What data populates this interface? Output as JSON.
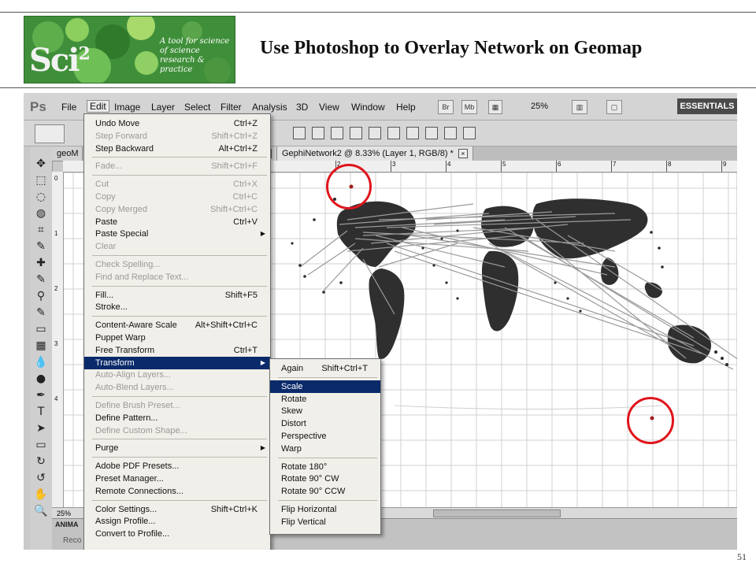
{
  "slide": {
    "title": "Use Photoshop to Overlay Network on Geomap",
    "page_number": "51",
    "logo": {
      "brand": "Sci",
      "sup": "2",
      "tagline": "A tool for science of science research & practice"
    }
  },
  "app": {
    "logo": "Ps",
    "menubar": [
      "File",
      "Edit",
      "Image",
      "Layer",
      "Select",
      "Filter",
      "Analysis",
      "3D",
      "View",
      "Window",
      "Help"
    ],
    "active_menu": "Edit",
    "bridge_btn": "Br",
    "minibridge_btn": "Mb",
    "zoom": "25%",
    "workspace": "ESSENTIALS"
  },
  "document_tabs": [
    {
      "label": "geoM",
      "close": "×"
    },
    {
      "label": ") *",
      "close": "×"
    },
    {
      "label": "GephiNetwork2 @ 8.33% (Layer 1, RGB/8) *",
      "close": "×"
    }
  ],
  "ruler_top": [
    "2",
    "3",
    "4",
    "5",
    "6",
    "7",
    "8",
    "9"
  ],
  "ruler_left": [
    "0",
    "1",
    "2",
    "3",
    "4"
  ],
  "status_zoom": "25%",
  "animation_panel": {
    "tab": "ANIMA",
    "record": "Reco"
  },
  "edit_menu": [
    {
      "label": "Undo Move",
      "shortcut": "Ctrl+Z",
      "disabled": false
    },
    {
      "label": "Step Forward",
      "shortcut": "Shift+Ctrl+Z",
      "disabled": true
    },
    {
      "label": "Step Backward",
      "shortcut": "Alt+Ctrl+Z",
      "disabled": false
    },
    {
      "sep": true
    },
    {
      "label": "Fade...",
      "shortcut": "Shift+Ctrl+F",
      "disabled": true
    },
    {
      "sep": true
    },
    {
      "label": "Cut",
      "shortcut": "Ctrl+X",
      "disabled": true
    },
    {
      "label": "Copy",
      "shortcut": "Ctrl+C",
      "disabled": true
    },
    {
      "label": "Copy Merged",
      "shortcut": "Shift+Ctrl+C",
      "disabled": true
    },
    {
      "label": "Paste",
      "shortcut": "Ctrl+V",
      "disabled": false
    },
    {
      "label": "Paste Special",
      "shortcut": "",
      "disabled": false,
      "submenu": true
    },
    {
      "label": "Clear",
      "shortcut": "",
      "disabled": true
    },
    {
      "sep": true
    },
    {
      "label": "Check Spelling...",
      "shortcut": "",
      "disabled": true
    },
    {
      "label": "Find and Replace Text...",
      "shortcut": "",
      "disabled": true
    },
    {
      "sep": true
    },
    {
      "label": "Fill...",
      "shortcut": "Shift+F5",
      "disabled": false
    },
    {
      "label": "Stroke...",
      "shortcut": "",
      "disabled": false
    },
    {
      "sep": true
    },
    {
      "label": "Content-Aware Scale",
      "shortcut": "Alt+Shift+Ctrl+C",
      "disabled": false
    },
    {
      "label": "Puppet Warp",
      "shortcut": "",
      "disabled": false
    },
    {
      "label": "Free Transform",
      "shortcut": "Ctrl+T",
      "disabled": false
    },
    {
      "label": "Transform",
      "shortcut": "",
      "disabled": false,
      "submenu": true,
      "highlighted": true
    },
    {
      "label": "Auto-Align Layers...",
      "shortcut": "",
      "disabled": true
    },
    {
      "label": "Auto-Blend Layers...",
      "shortcut": "",
      "disabled": true
    },
    {
      "sep": true
    },
    {
      "label": "Define Brush Preset...",
      "shortcut": "",
      "disabled": true
    },
    {
      "label": "Define Pattern...",
      "shortcut": "",
      "disabled": false
    },
    {
      "label": "Define Custom Shape...",
      "shortcut": "",
      "disabled": true
    },
    {
      "sep": true
    },
    {
      "label": "Purge",
      "shortcut": "",
      "disabled": false,
      "submenu": true
    },
    {
      "sep": true
    },
    {
      "label": "Adobe PDF Presets...",
      "shortcut": "",
      "disabled": false
    },
    {
      "label": "Preset Manager...",
      "shortcut": "",
      "disabled": false
    },
    {
      "label": "Remote Connections...",
      "shortcut": "",
      "disabled": false
    },
    {
      "sep": true
    },
    {
      "label": "Color Settings...",
      "shortcut": "Shift+Ctrl+K",
      "disabled": false
    },
    {
      "label": "Assign Profile...",
      "shortcut": "",
      "disabled": false
    },
    {
      "label": "Convert to Profile...",
      "shortcut": "",
      "disabled": false
    }
  ],
  "transform_menu": [
    {
      "label": "Again",
      "shortcut": "Shift+Ctrl+T"
    },
    {
      "sep": true
    },
    {
      "label": "Scale",
      "shortcut": "",
      "highlighted": true
    },
    {
      "label": "Rotate",
      "shortcut": ""
    },
    {
      "label": "Skew",
      "shortcut": ""
    },
    {
      "label": "Distort",
      "shortcut": ""
    },
    {
      "label": "Perspective",
      "shortcut": ""
    },
    {
      "label": "Warp",
      "shortcut": ""
    },
    {
      "sep": true
    },
    {
      "label": "Rotate 180°",
      "shortcut": ""
    },
    {
      "label": "Rotate 90° CW",
      "shortcut": ""
    },
    {
      "label": "Rotate 90° CCW",
      "shortcut": ""
    },
    {
      "sep": true
    },
    {
      "label": "Flip Horizontal",
      "shortcut": ""
    },
    {
      "label": "Flip Vertical",
      "shortcut": ""
    }
  ],
  "tools": [
    "move-icon",
    "marquee-icon",
    "lasso-icon",
    "quick-select-icon",
    "crop-icon",
    "eyedropper-icon",
    "healing-brush-icon",
    "brush-icon",
    "clone-stamp-icon",
    "history-brush-icon",
    "eraser-icon",
    "gradient-icon",
    "blur-icon",
    "dodge-icon",
    "pen-icon",
    "type-icon",
    "path-select-icon",
    "shape-icon",
    "3d-rotate-icon",
    "3d-orbit-icon",
    "hand-icon",
    "zoom-icon"
  ],
  "colors": {
    "highlight": "#0a2a6a",
    "annotation_circle": "#e0141b",
    "map_land": "#2f2f2f",
    "edges": "#9a9a9a"
  }
}
